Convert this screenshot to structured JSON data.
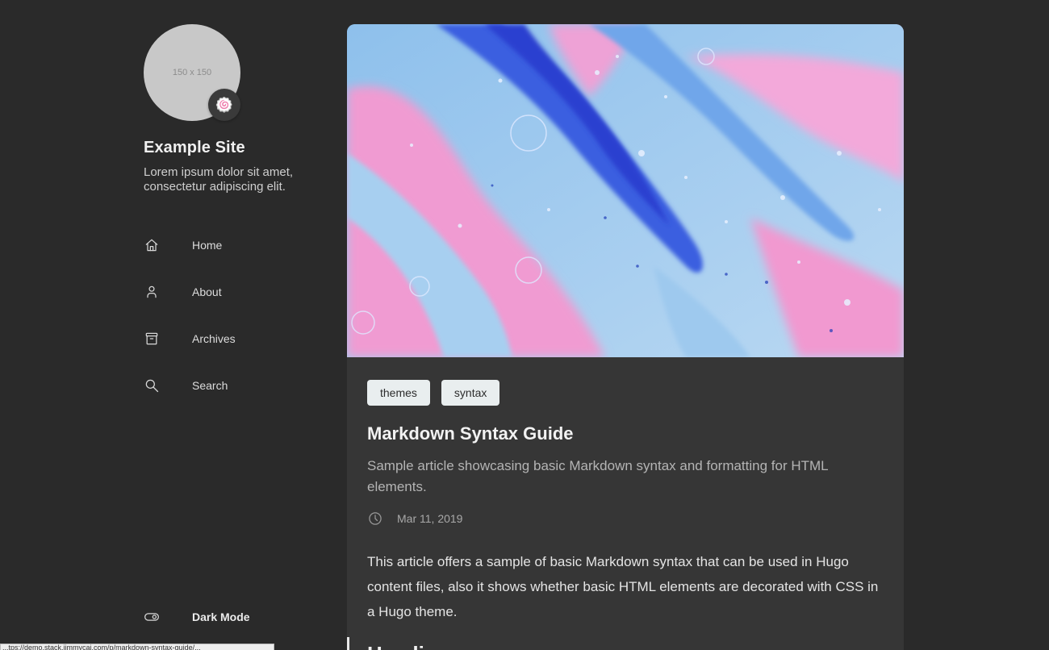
{
  "sidebar": {
    "avatar_placeholder": "150 x 150",
    "emoji": "🍥",
    "site_title": "Example Site",
    "site_description": "Lorem ipsum dolor sit amet, consectetur adipiscing elit.",
    "menu": [
      {
        "label": "Home",
        "icon": "home-icon"
      },
      {
        "label": "About",
        "icon": "user-icon"
      },
      {
        "label": "Archives",
        "icon": "archive-icon"
      },
      {
        "label": "Search",
        "icon": "search-icon"
      }
    ],
    "dark_mode_label": "Dark Mode"
  },
  "article": {
    "tags": [
      "themes",
      "syntax"
    ],
    "title": "Markdown Syntax Guide",
    "subtitle": "Sample article showcasing basic Markdown syntax and formatting for HTML elements.",
    "date": "Mar 11, 2019",
    "intro": "This article offers a sample of basic Markdown syntax that can be used in Hugo content files, also it shows whether basic HTML elements are decorated with CSS in a Hugo theme.",
    "next_heading": "Headings"
  },
  "status_bar": {
    "url_fragment": "...tps://demo.stack.jimmycai.com/p/markdown-syntax-guide/..."
  },
  "colors": {
    "background": "#2a2a2a",
    "card": "#363636",
    "tag_bg": "#e9eeef"
  }
}
